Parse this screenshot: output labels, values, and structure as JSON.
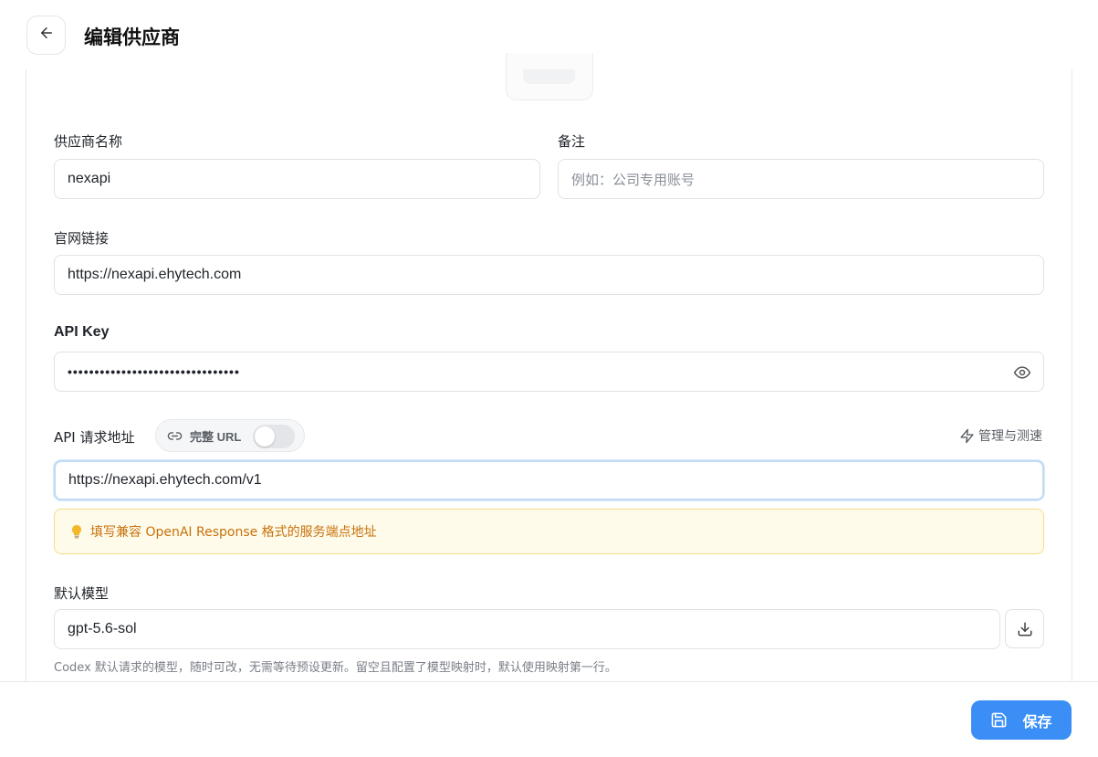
{
  "header": {
    "title": "编辑供应商"
  },
  "form": {
    "name": {
      "label": "供应商名称",
      "value": "nexapi"
    },
    "note": {
      "label": "备注",
      "placeholder": "例如：公司专用账号"
    },
    "website": {
      "label": "官网链接",
      "value": "https://nexapi.ehytech.com"
    },
    "api_key": {
      "label": "API Key",
      "value": "••••••••••••••••••••••••••••••••"
    },
    "endpoint": {
      "label": "API 请求地址",
      "toggle_label": "完整 URL",
      "toggle_on": false,
      "manage_label": "管理与测速",
      "value": "https://nexapi.ehytech.com/v1",
      "hint": "填写兼容 OpenAI Response 格式的服务端点地址"
    },
    "model": {
      "label": "默认模型",
      "value": "gpt-5.6-sol",
      "help": "Codex 默认请求的模型，随时可改，无需等待预设更新。留空且配置了模型映射时，默认使用映射第一行。"
    }
  },
  "footer": {
    "save_label": "保存"
  },
  "colors": {
    "primary": "#3a8ef6",
    "hint_text": "#c8710d",
    "hint_bg": "#fefbea",
    "hint_border": "#f5dc8a"
  },
  "icons": [
    "arrow-left-icon",
    "link-icon",
    "eye-icon",
    "zap-icon",
    "lightbulb-icon",
    "download-icon",
    "save-icon"
  ]
}
